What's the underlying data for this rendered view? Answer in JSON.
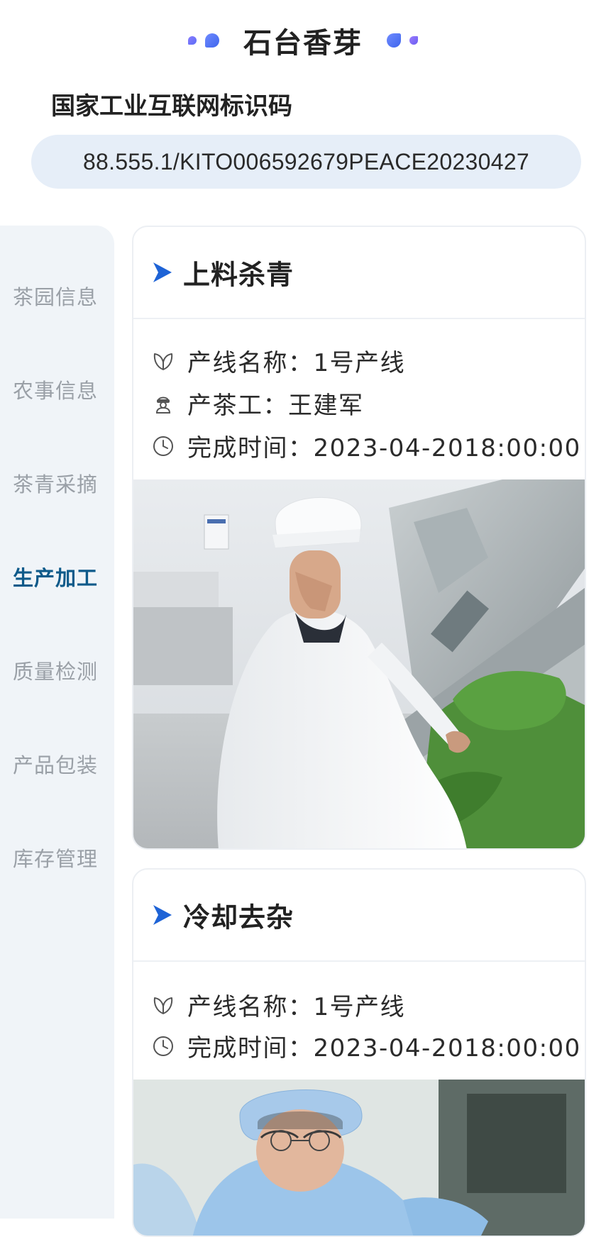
{
  "header": {
    "title": "石台香芽",
    "id_label": "国家工业互联网标识码",
    "id_code": "88.555.1/KITO006592679PEACE20230427"
  },
  "sidebar": {
    "items": [
      {
        "label": "茶园信息",
        "active": false
      },
      {
        "label": "农事信息",
        "active": false
      },
      {
        "label": "茶青采摘",
        "active": false
      },
      {
        "label": "生产加工",
        "active": true
      },
      {
        "label": "质量检测",
        "active": false
      },
      {
        "label": "产品包装",
        "active": false
      },
      {
        "label": "库存管理",
        "active": false
      }
    ]
  },
  "cards": [
    {
      "title": "上料杀青",
      "line": "产线名称：1号产线",
      "worker": "产茶工：王建军",
      "time": "完成时间：2023-04-2018:00:00"
    },
    {
      "title": "冷却去杂",
      "line": "产线名称：1号产线",
      "time": "完成时间：2023-04-2018:00:00"
    }
  ],
  "colors": {
    "accent": "#1e63d6",
    "active_nav": "#0e5a8a",
    "sidebar_bg": "#f0f4f8",
    "pill_bg": "#e6eef8"
  },
  "icons": {
    "arrow": "chevron-right-icon",
    "line": "leaf-icon",
    "worker": "worker-icon",
    "time": "clock-icon"
  }
}
